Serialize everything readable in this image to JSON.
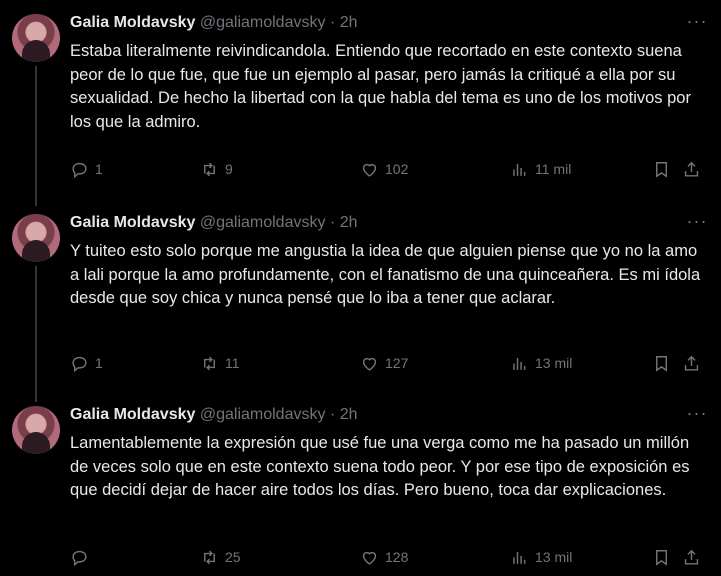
{
  "tweets": [
    {
      "author_name": "Galia Moldavsky",
      "handle": "@galiamoldavsky",
      "separator": "·",
      "time": "2h",
      "text": "Estaba literalmente reivindicandola. Entiendo que recortado en este contexto suena peor de lo que fue, que fue un ejemplo al pasar, pero jamás la critiqué a ella por su sexualidad. De hecho la libertad con la que habla del tema es uno de los motivos por los que la admiro.",
      "replies": "1",
      "retweets": "9",
      "likes": "102",
      "views": "11 mil"
    },
    {
      "author_name": "Galia Moldavsky",
      "handle": "@galiamoldavsky",
      "separator": "·",
      "time": "2h",
      "text": "Y tuiteo esto solo porque me angustia la idea de que alguien piense que yo no la amo a lali porque la amo profundamente, con el fanatismo de una quinceañera. Es mi ídola desde que soy chica y nunca pensé que lo iba a tener que aclarar.",
      "replies": "1",
      "retweets": "11",
      "likes": "127",
      "views": "13 mil"
    },
    {
      "author_name": "Galia Moldavsky",
      "handle": "@galiamoldavsky",
      "separator": "·",
      "time": "2h",
      "text": "Lamentablemente la expresión que usé fue una verga como me ha pasado un millón de veces solo que en este contexto suena todo peor. Y por ese tipo de exposición es que decidí dejar de hacer aire todos los días. Pero bueno, toca dar explicaciones.",
      "replies": "",
      "retweets": "25",
      "likes": "128",
      "views": "13 mil"
    }
  ],
  "icons": {
    "reply": "reply-icon",
    "retweet": "retweet-icon",
    "like": "heart-icon",
    "views": "views-icon",
    "bookmark": "bookmark-icon",
    "share": "share-icon",
    "more": "more-icon"
  },
  "colors": {
    "background": "#000000",
    "text": "#e7e9ea",
    "muted": "#71767b"
  }
}
